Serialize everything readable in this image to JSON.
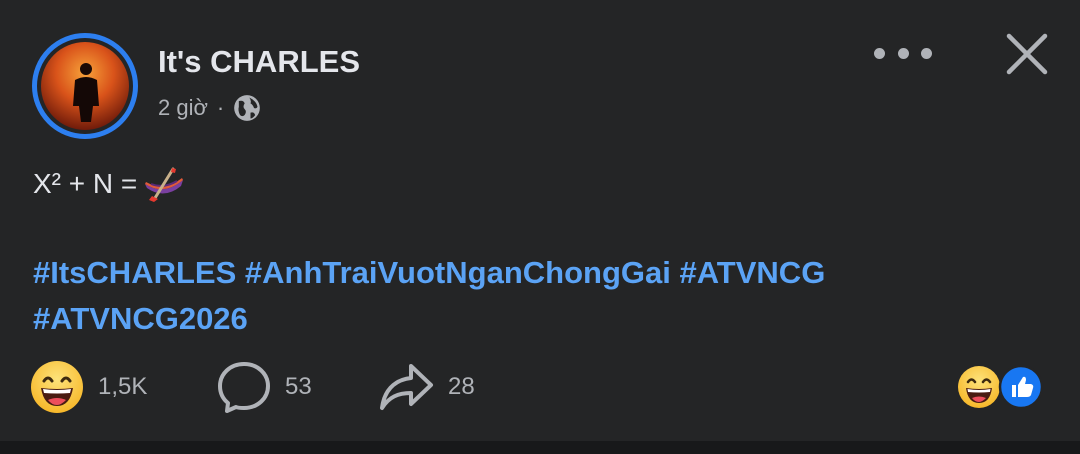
{
  "post": {
    "author": "It's CHARLES",
    "time": "2 giờ",
    "separator": "·",
    "text": "X² + N =",
    "hashtags": [
      "#ItsCHARLES",
      "#AnhTraiVuotNganChongGai",
      "#ATVNCG",
      "#ATVNCG2026"
    ]
  },
  "actions": {
    "reactions_count": "1,5K",
    "comments_count": "53",
    "shares_count": "28"
  },
  "icons": {
    "privacy": "globe-icon",
    "more": "more-icon",
    "close": "close-icon",
    "reaction": "laughing-emoji-icon",
    "comment": "comment-icon",
    "share": "share-icon",
    "summary_like": "like-icon",
    "inline_emoji": "canoe-emoji"
  },
  "colors": {
    "background": "#242526",
    "text_primary": "#e4e6eb",
    "text_secondary": "#b0b3b8",
    "hashtag": "#5ba3f5",
    "avatar_ring": "#2d7ff0",
    "like_blue": "#1877f2"
  }
}
